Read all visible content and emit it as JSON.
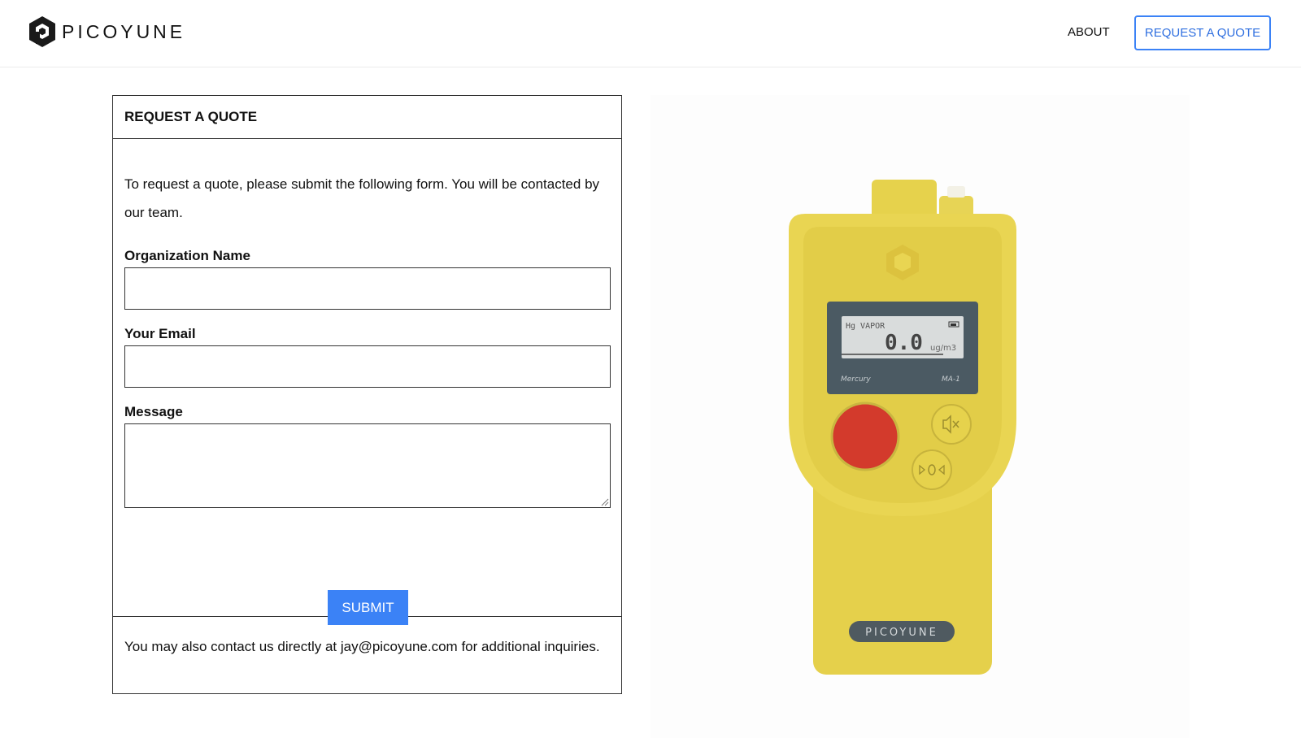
{
  "header": {
    "brand": "PICOYUNE",
    "nav": {
      "about": "ABOUT",
      "request_quote": "REQUEST A QUOTE"
    }
  },
  "form": {
    "title": "REQUEST A QUOTE",
    "intro": "To request a quote, please submit the following form. You will be contacted by our team.",
    "fields": {
      "organization": {
        "label": "Organization Name",
        "value": "",
        "placeholder": ""
      },
      "email": {
        "label": "Your Email",
        "value": "",
        "placeholder": ""
      },
      "message": {
        "label": "Message",
        "value": "",
        "placeholder": ""
      }
    },
    "submit_label": "SUBMIT",
    "footer_note": "You may also contact us directly at jay@picoyune.com for additional inquiries."
  },
  "product": {
    "display_top_label": "Hg VAPOR",
    "display_reading": "0.0",
    "display_unit": "ug/m3",
    "panel_left_label": "Mercury",
    "panel_right_label": "MA-1",
    "body_brand": "PICOYUNE"
  },
  "colors": {
    "accent_blue": "#3b82f6",
    "device_yellow": "#e8d451",
    "device_button_red": "#d33a2c",
    "device_screen_panel": "#4b5a63"
  },
  "icons": [
    "picoyune-logo-icon",
    "mute-icon",
    "zero-icon",
    "resize-grip-icon"
  ]
}
